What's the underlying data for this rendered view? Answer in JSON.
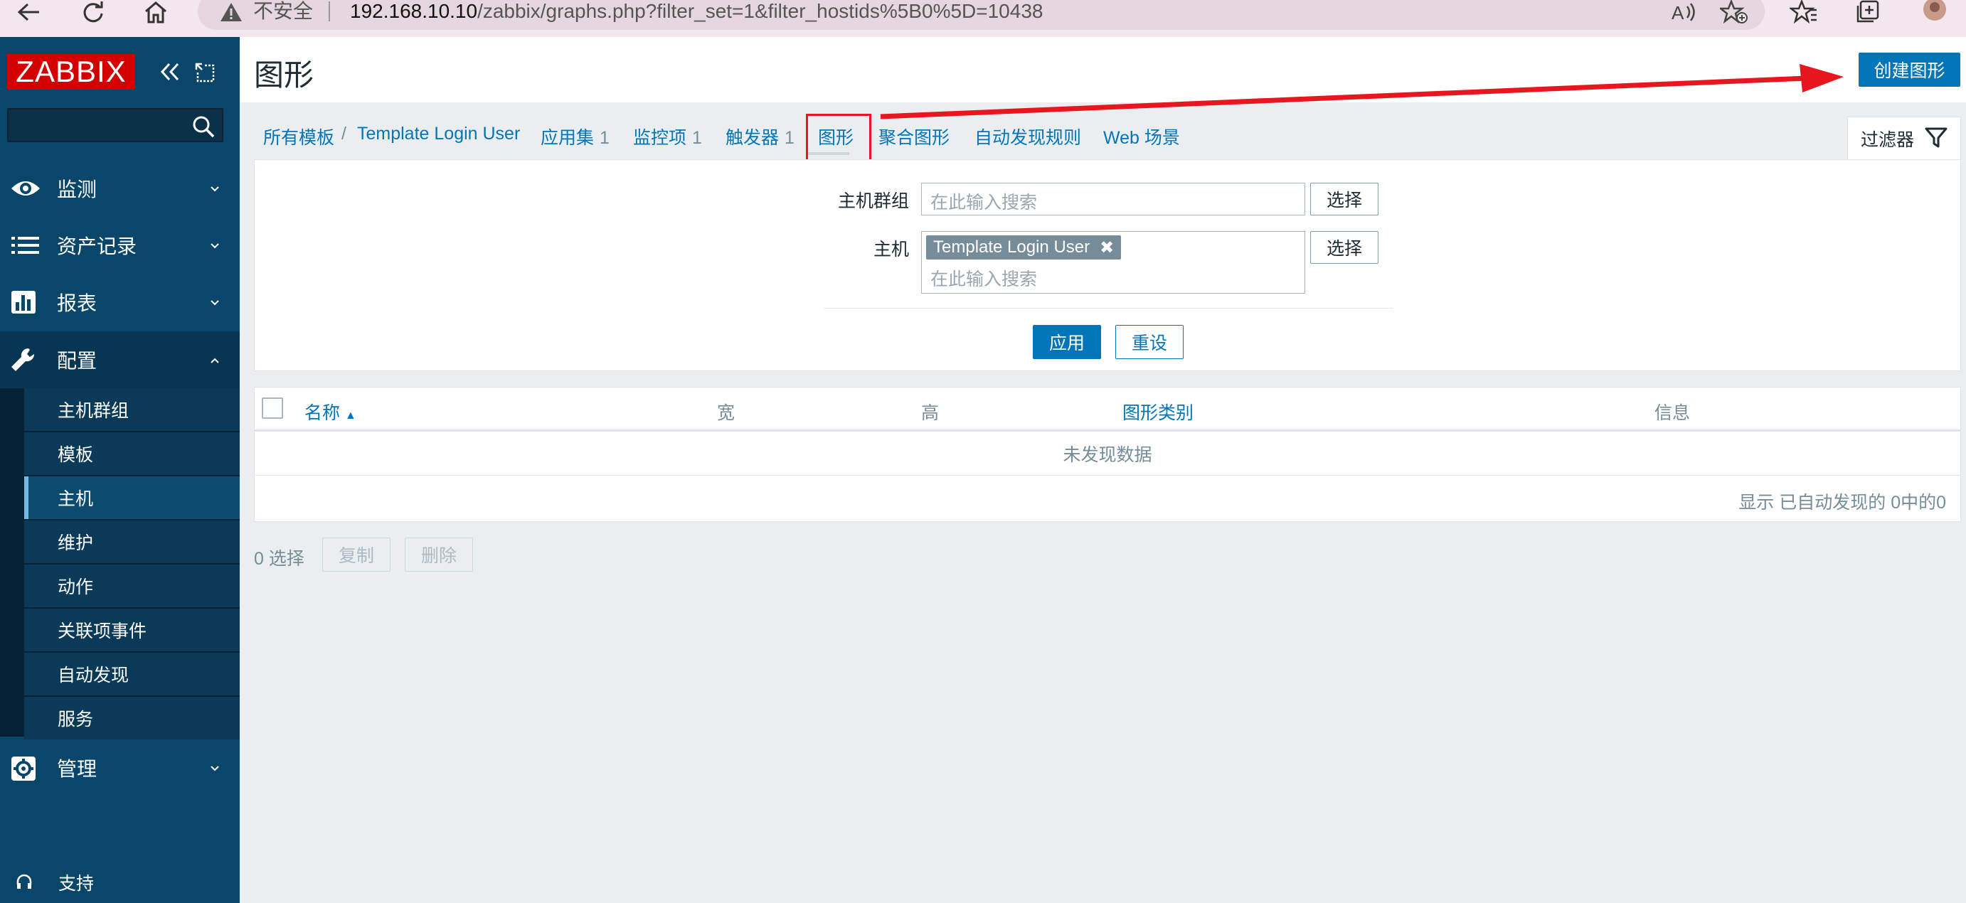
{
  "browser": {
    "insecure_label": "不安全",
    "url_domain": "192.168.10.10",
    "url_path": "/zabbix/graphs.php?filter_set=1&filter_hostids%5B0%5D=10438"
  },
  "sidebar": {
    "logo": "ZABBIX",
    "search_value": "",
    "menu": [
      {
        "label": "监测",
        "icon": "eye-icon"
      },
      {
        "label": "资产记录",
        "icon": "list-icon"
      },
      {
        "label": "报表",
        "icon": "bar-chart-icon"
      },
      {
        "label": "配置",
        "icon": "wrench-icon"
      },
      {
        "label": "管理",
        "icon": "gear-icon"
      }
    ],
    "config_submenu": [
      {
        "label": "主机群组"
      },
      {
        "label": "模板"
      },
      {
        "label": "主机"
      },
      {
        "label": "维护"
      },
      {
        "label": "动作"
      },
      {
        "label": "关联项事件"
      },
      {
        "label": "自动发现"
      },
      {
        "label": "服务"
      }
    ],
    "active_submenu": "主机",
    "support_label": "支持"
  },
  "header": {
    "title": "图形",
    "create_button": "创建图形"
  },
  "tabs": {
    "breadcrumb_root": "所有模板",
    "breadcrumb_sep": "/",
    "breadcrumb_host": "Template Login User",
    "items": [
      {
        "label": "应用集",
        "count": "1"
      },
      {
        "label": "监控项",
        "count": "1"
      },
      {
        "label": "触发器",
        "count": "1"
      },
      {
        "label": "图形",
        "count": ""
      },
      {
        "label": "聚合图形",
        "count": ""
      },
      {
        "label": "自动发现规则",
        "count": ""
      },
      {
        "label": "Web 场景",
        "count": ""
      }
    ],
    "active": "图形"
  },
  "filter": {
    "tab_label": "过滤器",
    "host_group_label": "主机群组",
    "host_group_placeholder": "在此输入搜索",
    "host_label": "主机",
    "host_tag": "Template Login User",
    "host_placeholder": "在此输入搜索",
    "select_button": "选择",
    "apply_button": "应用",
    "reset_button": "重设"
  },
  "table": {
    "columns": [
      "名称",
      "宽",
      "高",
      "图形类别",
      "信息"
    ],
    "sort_column": "名称",
    "sort_direction": "asc",
    "empty_text": "未发现数据",
    "footer_text": "显示 已自动发现的 0中的0"
  },
  "bottom": {
    "selected_count": "0 选择",
    "copy_button": "复制",
    "delete_button": "删除"
  },
  "colors": {
    "sidebar_bg": "#0a466a",
    "accent": "#0275b8",
    "logo_red": "#d40000",
    "annotation_red": "#e8161e"
  }
}
